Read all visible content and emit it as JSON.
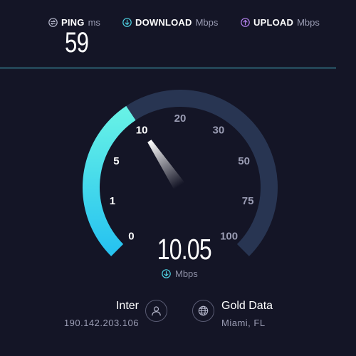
{
  "header": {
    "ping": {
      "label": "PING",
      "unit": "ms",
      "value": "59",
      "icon": "ping-icon"
    },
    "download": {
      "label": "DOWNLOAD",
      "unit": "Mbps",
      "icon": "download-arrow-icon"
    },
    "upload": {
      "label": "UPLOAD",
      "unit": "Mbps",
      "icon": "upload-arrow-icon"
    }
  },
  "gauge": {
    "ticks": [
      "0",
      "1",
      "5",
      "10",
      "20",
      "30",
      "50",
      "75",
      "100"
    ],
    "current_value": "10.05",
    "unit": "Mbps",
    "needle_value": 10.05,
    "colors": {
      "track": "#283552",
      "active_start": "#27c3f0",
      "active_end": "#66f1e6",
      "needle": "#ffffff"
    }
  },
  "isp": {
    "name": "Inter",
    "ip": "190.142.203.106",
    "icon": "user-icon"
  },
  "server": {
    "name": "Gold Data",
    "location": "Miami, FL",
    "icon": "globe-icon"
  },
  "colors": {
    "background": "#141526",
    "progress_line": "#4fc6d8",
    "ping_icon": "#b6b8cc",
    "download_icon": "#4fd3e3",
    "upload_icon": "#b583f0"
  }
}
